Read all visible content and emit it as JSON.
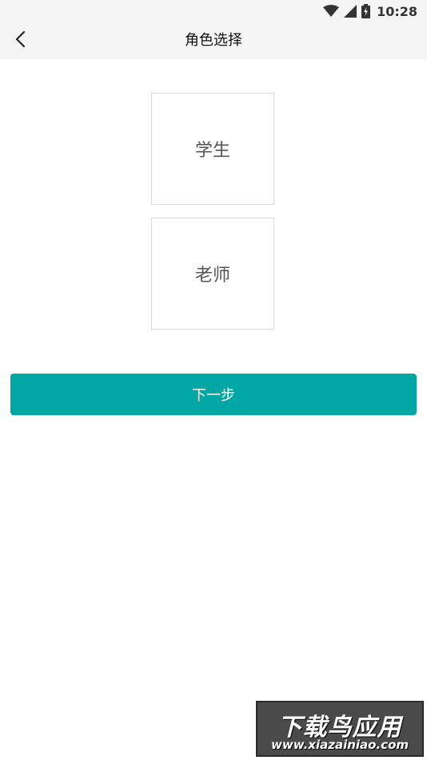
{
  "status_bar": {
    "time": "10:28",
    "icons": [
      "wifi-icon",
      "signal-icon",
      "battery-icon"
    ]
  },
  "nav": {
    "title": "角色选择",
    "back_icon": "chevron-left-icon"
  },
  "roles": [
    {
      "label": "学生"
    },
    {
      "label": "老师"
    }
  ],
  "next_button": {
    "label": "下一步"
  },
  "watermark": {
    "title": "下载鸟应用",
    "url": "www.xiazainiao.com"
  },
  "colors": {
    "accent": "#00a7a4",
    "nav_bg": "#f5f5f5",
    "card_border": "#d9d9d9",
    "card_text": "#555555"
  }
}
